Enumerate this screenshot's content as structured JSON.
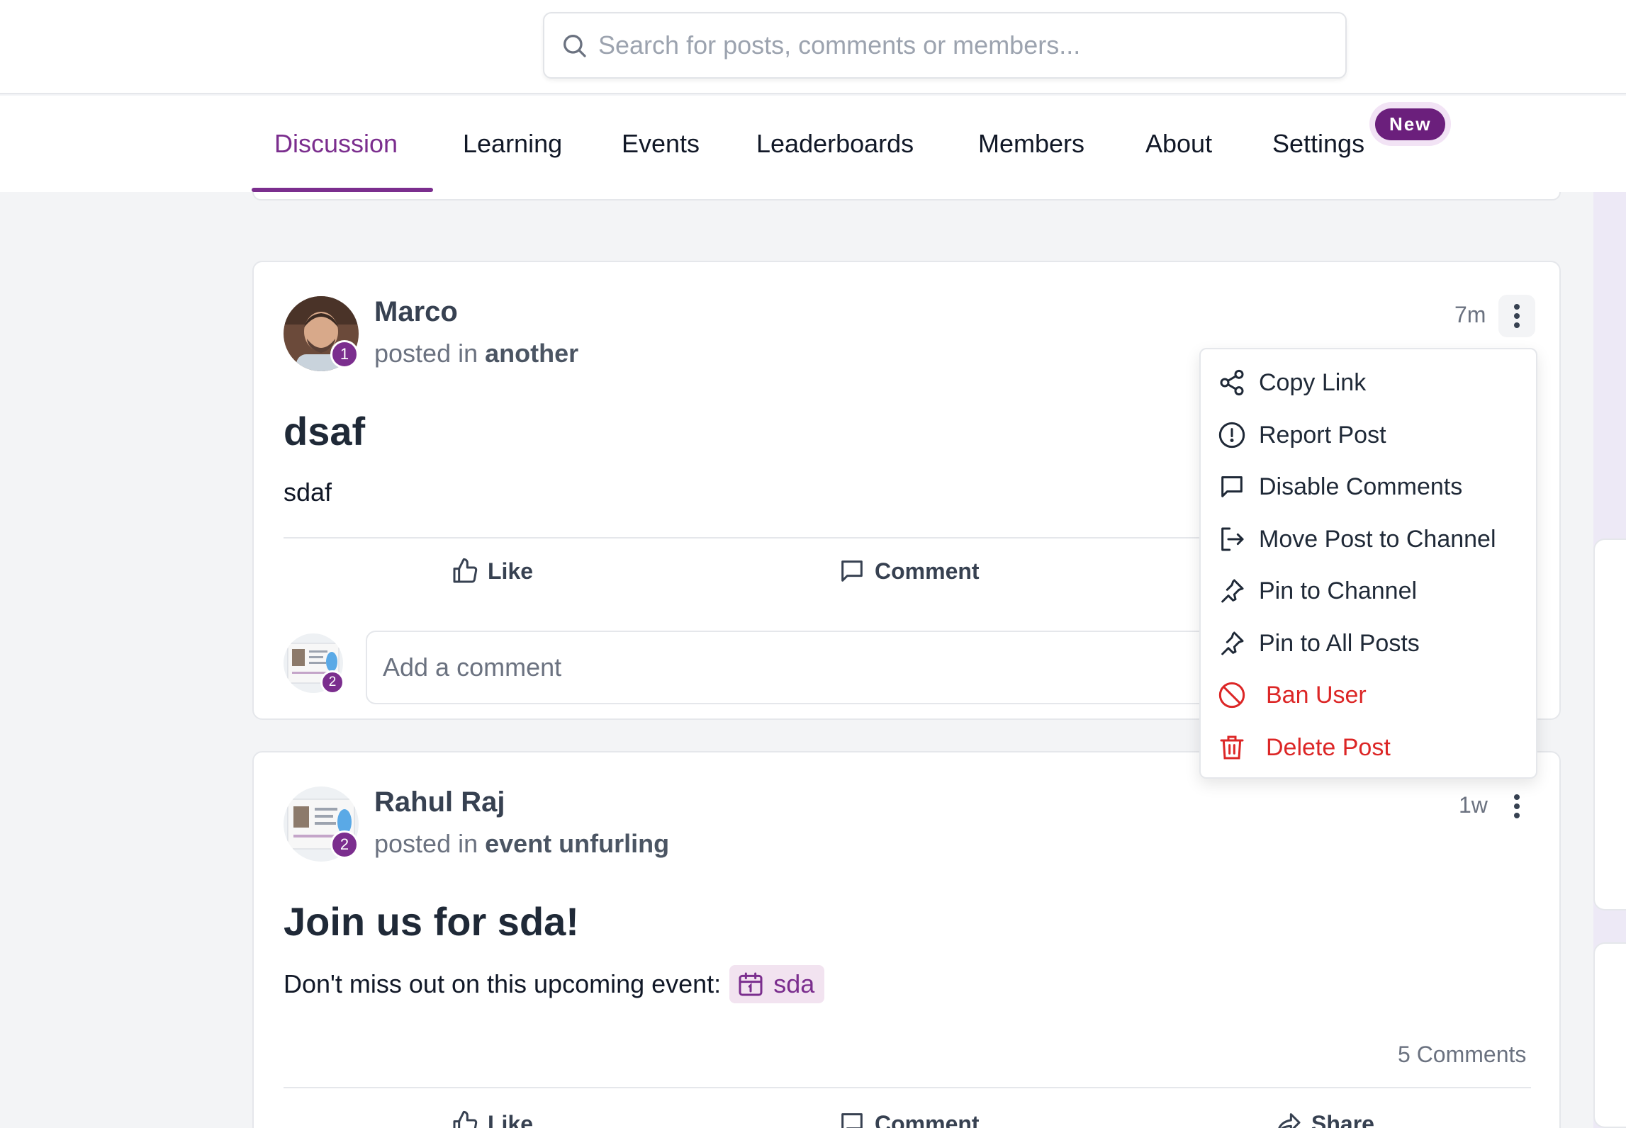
{
  "search": {
    "placeholder": "Search for posts, comments or members..."
  },
  "tabs": [
    {
      "label": "Discussion",
      "active": true
    },
    {
      "label": "Learning"
    },
    {
      "label": "Events"
    },
    {
      "label": "Leaderboards"
    },
    {
      "label": "Members"
    },
    {
      "label": "About"
    },
    {
      "label": "Settings",
      "badge": "New"
    }
  ],
  "posts": [
    {
      "author": "Marco",
      "level": "1",
      "posted_in_prefix": "posted in",
      "channel": "another",
      "time": "7m",
      "title": "dsaf",
      "body": "sdaf",
      "actions": {
        "like": "Like",
        "comment": "Comment"
      },
      "comment_placeholder": "Add a comment",
      "commenter_level": "2"
    },
    {
      "author": "Rahul Raj",
      "level": "2",
      "posted_in_prefix": "posted in",
      "channel": "event unfurling",
      "time": "1w",
      "title": "Join us for sda!",
      "body": "Don't miss out on this upcoming event:",
      "event_chip": "sda",
      "comments_count": "5 Comments",
      "actions": {
        "like": "Like",
        "comment": "Comment",
        "share": "Share"
      }
    }
  ],
  "post_menu": {
    "items": [
      {
        "label": "Copy Link",
        "icon": "share-nodes-icon"
      },
      {
        "label": "Report Post",
        "icon": "alert-circle-icon"
      },
      {
        "label": "Disable Comments",
        "icon": "comment-icon"
      },
      {
        "label": "Move Post to Channel",
        "icon": "move-icon"
      },
      {
        "label": "Pin to Channel",
        "icon": "pin-icon"
      },
      {
        "label": "Pin to All Posts",
        "icon": "pin-icon"
      },
      {
        "label": "Ban User",
        "icon": "ban-icon",
        "danger": true
      },
      {
        "label": "Delete Post",
        "icon": "trash-icon",
        "danger": true
      }
    ]
  },
  "colors": {
    "accent": "#7b2e8e",
    "danger": "#dc2626",
    "badge": "#6b1f7c"
  }
}
